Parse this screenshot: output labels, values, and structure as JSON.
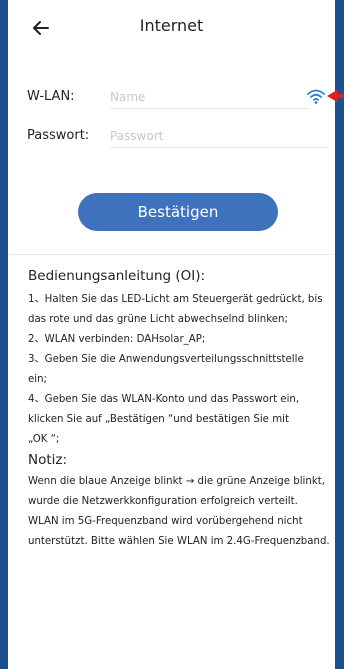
{
  "header": {
    "title": "Internet",
    "back_icon": "arrow-left-icon"
  },
  "form": {
    "wlan": {
      "label": "W-LAN:",
      "placeholder": "Name",
      "value": "",
      "icon": "wifi-icon"
    },
    "password": {
      "label": "Passwort:",
      "placeholder": "Passwort",
      "value": ""
    },
    "confirm_label": "Bestätigen",
    "accent_color": "#3f72bd",
    "marker_color": "#e0201a"
  },
  "manual": {
    "heading": "Bedienungsanleitung (OI):",
    "lines": [
      "1、Halten Sie das LED-Licht am Steuergerät gedrückt, bis",
      "das rote und das grüne Licht abwechselnd blinken;",
      "2、WLAN verbinden: DAHsolar_AP;",
      "3、Geben Sie die Anwendungsverteilungsschnittstelle",
      "ein;",
      "4、Geben Sie das WLAN-Konto und das Passwort ein,",
      "klicken Sie auf „Bestätigen “und bestätigen Sie mit",
      "„OK “;"
    ],
    "notiz_heading": "Notiz:",
    "notiz_lines": [
      "Wenn die blaue Anzeige blinkt → die grüne Anzeige blinkt,",
      "wurde die Netzwerkkonfiguration erfolgreich verteilt.",
      "WLAN im 5G-Frequenzband wird vorübergehend nicht",
      "unterstützt. Bitte wählen Sie WLAN im 2.4G-Frequenzband."
    ]
  }
}
